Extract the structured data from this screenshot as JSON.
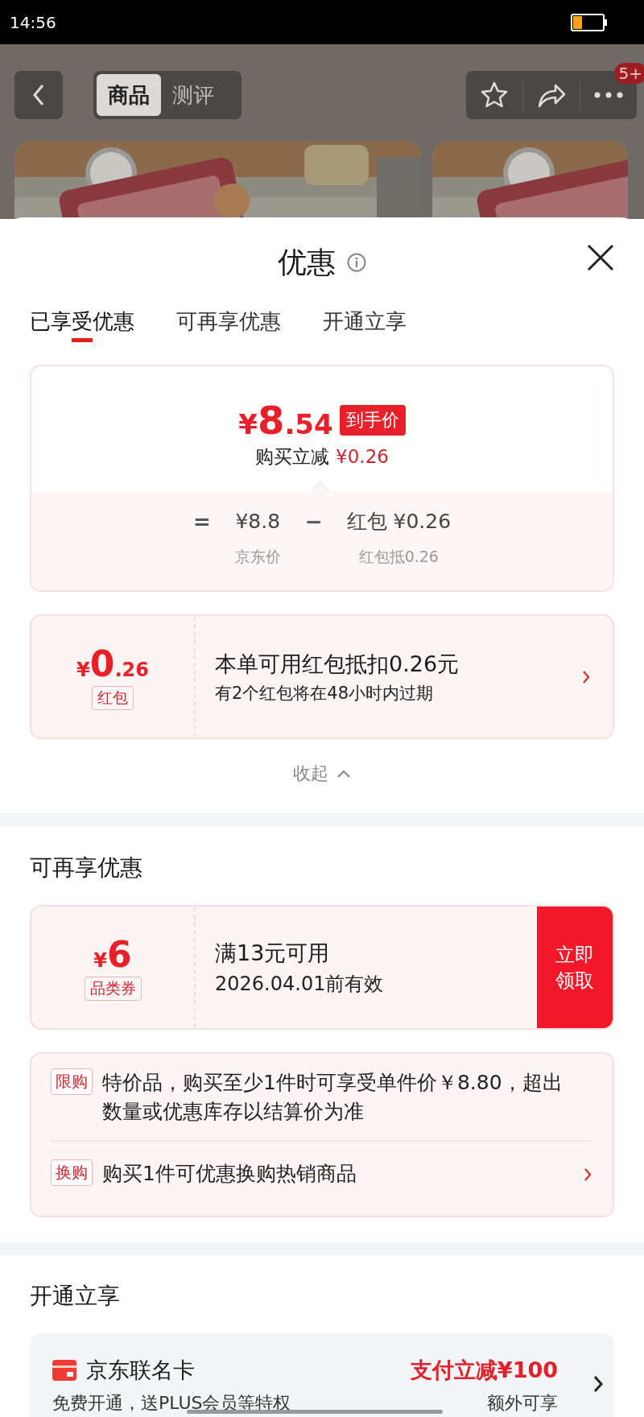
{
  "status_bar": {
    "time": "14:56"
  },
  "header": {
    "tabs": [
      {
        "label": "商品",
        "selected": true
      },
      {
        "label": "测评",
        "selected": false
      }
    ],
    "badge": "5+"
  },
  "sheet": {
    "title": "优惠",
    "tabs": [
      {
        "label": "已享受优惠",
        "selected": true
      },
      {
        "label": "可再享优惠",
        "selected": false
      },
      {
        "label": "开通立享",
        "selected": false
      }
    ]
  },
  "price_card": {
    "currency": "¥",
    "amount": "8",
    "decimals": ".54",
    "tag": "到手价",
    "saving_label": "购买立减",
    "saving": "¥0.26",
    "formula": [
      {
        "kind": "op",
        "text": "="
      },
      {
        "kind": "term",
        "value": "¥8.8",
        "caption": "京东价"
      },
      {
        "kind": "op",
        "text": "−"
      },
      {
        "kind": "term",
        "value": "红包 ¥0.26",
        "caption": "红包抵0.26"
      }
    ]
  },
  "red_packet": {
    "currency": "¥",
    "amount": "0",
    "decimals": ".26",
    "tag": "红包",
    "title": "本单可用红包抵扣0.26元",
    "subtitle": "有2个红包将在48小时内过期"
  },
  "collapse": "收起",
  "more_offers": {
    "heading": "可再享优惠",
    "coupon": {
      "currency": "¥",
      "amount": "6",
      "tag": "品类券",
      "condition": "满13元可用",
      "validity": "2026.04.01前有效",
      "action": "立即领取"
    },
    "notes": [
      {
        "tag": "限购",
        "text": "特价品，购买至少1件时可享受单件价￥8.80，超出数量或优惠库存以结算价为准",
        "has_arrow": false
      },
      {
        "tag": "换购",
        "text": "购买1件可优惠换购热销商品",
        "has_arrow": true
      }
    ]
  },
  "open_now": {
    "heading": "开通立享",
    "card": {
      "name": "京东联名卡",
      "offer": "支付立减¥100",
      "desc": "免费开通，送PLUS会员等特权",
      "extra": "额外可享"
    }
  }
}
